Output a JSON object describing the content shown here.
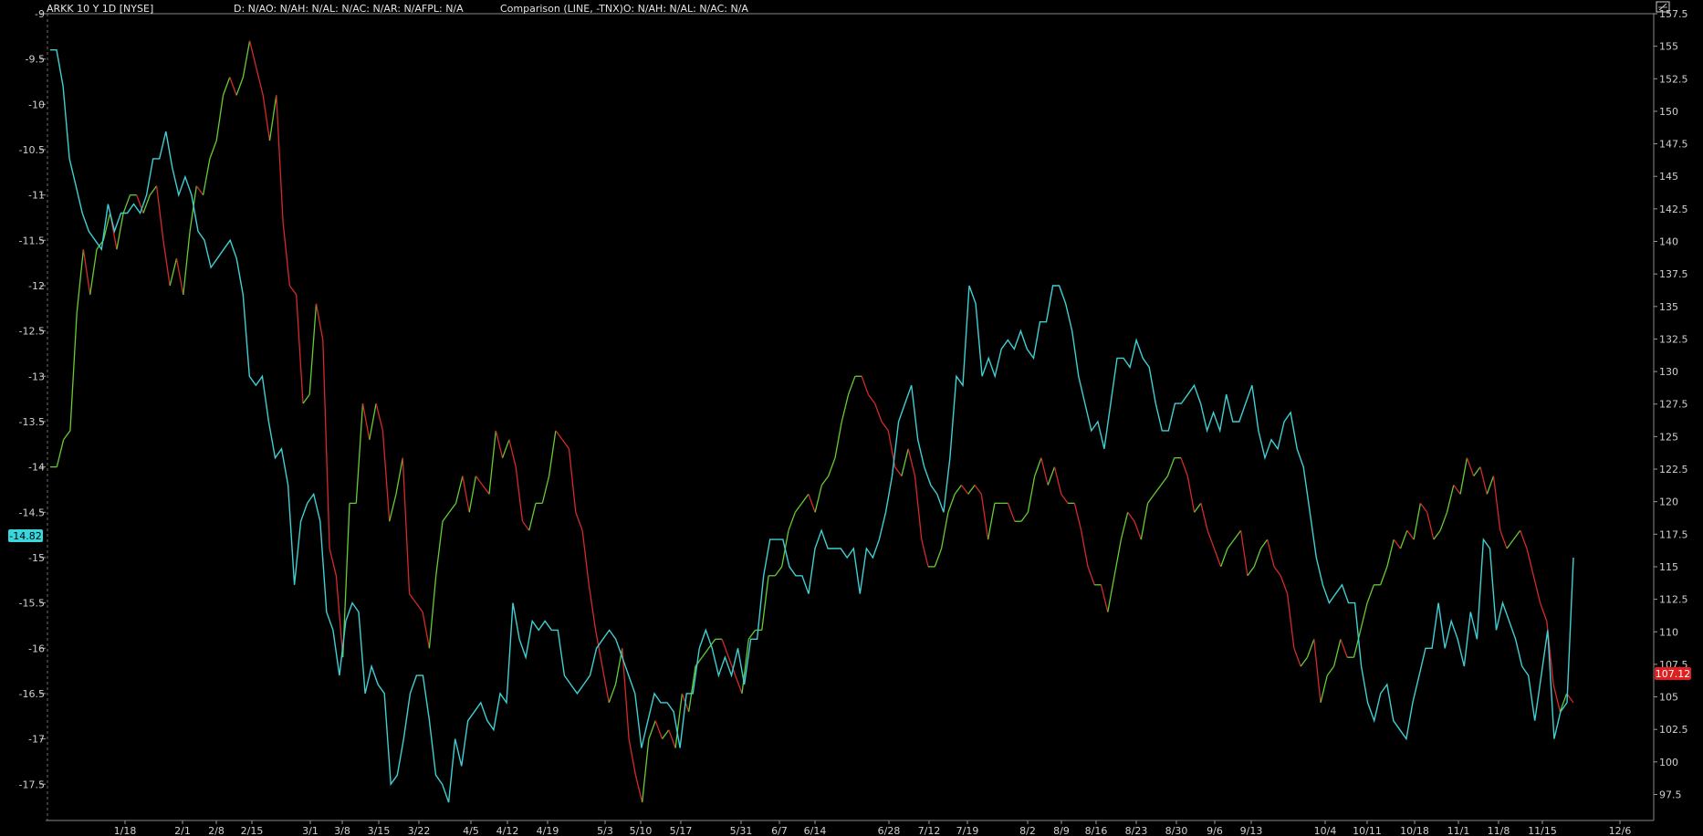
{
  "header": {
    "symbol": "ARKK 10 Y 1D [NYSE]",
    "study_line": "D: N/AO: N/AH: N/AL: N/AC: N/AR: N/AFPL: N/A",
    "comparison_line": "Comparison (LINE, -TNX)O: N/AH: N/AL: N/AC: N/A"
  },
  "colors": {
    "background": "#000000",
    "up": "#66cc33",
    "down": "#d42a2a",
    "comparison": "#3fcfd3",
    "axis": "#9a9a9a",
    "left_badge": "#39d7dd",
    "right_badge": "#e02020"
  },
  "badges": {
    "left_value": "-14.82",
    "right_value": "107.12"
  },
  "chart_data": {
    "type": "line",
    "x_ticks": [
      "1/18",
      "2/1",
      "2/8",
      "2/15",
      "3/1",
      "3/8",
      "3/15",
      "3/22",
      "4/5",
      "4/12",
      "4/19",
      "5/3",
      "5/10",
      "5/17",
      "5/31",
      "6/7",
      "6/14",
      "6/28",
      "7/12",
      "7/19",
      "8/2",
      "8/9",
      "8/16",
      "8/23",
      "8/30",
      "9/6",
      "9/13",
      "10/4",
      "10/11",
      "10/18",
      "11/1",
      "11/8",
      "11/15",
      "12/6"
    ],
    "left_axis": {
      "ylim": [
        -17.9,
        -9
      ],
      "ticks": [
        "-9",
        "-9.5",
        "-10",
        "-10.5",
        "-11",
        "-11.5",
        "-12",
        "-12.5",
        "-13",
        "-13.5",
        "-14",
        "-14.5",
        "-15",
        "-15.5",
        "-16",
        "-16.5",
        "-17",
        "-17.5"
      ]
    },
    "right_axis": {
      "ylim": [
        95.5,
        157.5
      ],
      "ticks": [
        "157.5",
        "155",
        "152.5",
        "150",
        "147.5",
        "145",
        "142.5",
        "140",
        "137.5",
        "135",
        "132.5",
        "130",
        "127.5",
        "125",
        "122.5",
        "120",
        "117.5",
        "115",
        "112.5",
        "110",
        "107.5",
        "105",
        "102.5",
        "100",
        "97.5"
      ]
    },
    "series": [
      {
        "axis": "left",
        "style": "updown",
        "values": [
          -14.0,
          -14.0,
          -13.7,
          -13.6,
          -12.3,
          -11.6,
          -12.1,
          -11.6,
          -11.5,
          -11.2,
          -11.6,
          -11.2,
          -11.0,
          -11.0,
          -11.2,
          -11.0,
          -10.9,
          -11.5,
          -12.0,
          -11.7,
          -12.1,
          -11.4,
          -10.9,
          -11.0,
          -10.6,
          -10.4,
          -9.9,
          -9.7,
          -9.9,
          -9.7,
          -9.3,
          -9.6,
          -9.9,
          -10.4,
          -9.9,
          -11.3,
          -12.0,
          -12.1,
          -13.3,
          -13.2,
          -12.2,
          -12.6,
          -14.9,
          -15.2,
          -16.1,
          -14.4,
          -14.4,
          -13.3,
          -13.7,
          -13.3,
          -13.6,
          -14.6,
          -14.3,
          -13.9,
          -15.4,
          -15.5,
          -15.6,
          -16.0,
          -15.2,
          -14.6,
          -14.5,
          -14.4,
          -14.1,
          -14.5,
          -14.1,
          -14.2,
          -14.3,
          -13.6,
          -13.9,
          -13.7,
          -14.0,
          -14.6,
          -14.7,
          -14.4,
          -14.4,
          -14.1,
          -13.6,
          -13.7,
          -13.8,
          -14.5,
          -14.7,
          -15.3,
          -15.8,
          -16.2,
          -16.6,
          -16.4,
          -16.0,
          -17.0,
          -17.4,
          -17.7,
          -17.0,
          -16.8,
          -17.0,
          -16.9,
          -17.1,
          -16.5,
          -16.7,
          -16.2,
          -16.1,
          -16.0,
          -15.9,
          -15.9,
          -16.1,
          -16.3,
          -16.5,
          -15.9,
          -15.8,
          -15.8,
          -15.2,
          -15.2,
          -15.1,
          -14.7,
          -14.5,
          -14.4,
          -14.3,
          -14.5,
          -14.2,
          -14.1,
          -13.9,
          -13.5,
          -13.2,
          -13.0,
          -13.0,
          -13.2,
          -13.3,
          -13.5,
          -13.6,
          -14.0,
          -14.1,
          -13.8,
          -14.1,
          -14.8,
          -15.1,
          -15.1,
          -14.9,
          -14.5,
          -14.3,
          -14.2,
          -14.3,
          -14.2,
          -14.3,
          -14.8,
          -14.4,
          -14.4,
          -14.4,
          -14.6,
          -14.6,
          -14.5,
          -14.1,
          -13.9,
          -14.2,
          -14.0,
          -14.3,
          -14.4,
          -14.4,
          -14.7,
          -15.1,
          -15.3,
          -15.3,
          -15.6,
          -15.2,
          -14.8,
          -14.5,
          -14.6,
          -14.8,
          -14.4,
          -14.3,
          -14.2,
          -14.1,
          -13.9,
          -13.9,
          -14.1,
          -14.5,
          -14.4,
          -14.7,
          -14.9,
          -15.1,
          -14.9,
          -14.8,
          -14.7,
          -15.2,
          -15.1,
          -14.9,
          -14.8,
          -15.1,
          -15.2,
          -15.4,
          -16.0,
          -16.2,
          -16.1,
          -15.9,
          -16.6,
          -16.3,
          -16.2,
          -15.9,
          -16.1,
          -16.1,
          -15.8,
          -15.5,
          -15.3,
          -15.3,
          -15.1,
          -14.8,
          -14.9,
          -14.7,
          -14.8,
          -14.4,
          -14.5,
          -14.8,
          -14.7,
          -14.5,
          -14.2,
          -14.3,
          -13.9,
          -14.1,
          -14.0,
          -14.3,
          -14.1,
          -14.7,
          -14.9,
          -14.8,
          -14.7,
          -14.9,
          -15.2,
          -15.5,
          -15.7,
          -16.4,
          -16.7,
          -16.5,
          -16.6
        ]
      },
      {
        "axis": "left",
        "style": "comparison",
        "values": [
          -9.4,
          -9.4,
          -9.8,
          -10.6,
          -10.9,
          -11.2,
          -11.4,
          -11.5,
          -11.6,
          -11.1,
          -11.4,
          -11.2,
          -11.2,
          -11.1,
          -11.2,
          -11.0,
          -10.6,
          -10.6,
          -10.3,
          -10.7,
          -11.0,
          -10.8,
          -11.0,
          -11.4,
          -11.5,
          -11.8,
          -11.7,
          -11.6,
          -11.5,
          -11.7,
          -12.1,
          -13.0,
          -13.1,
          -13.0,
          -13.5,
          -13.9,
          -13.8,
          -14.2,
          -15.3,
          -14.6,
          -14.4,
          -14.3,
          -14.6,
          -15.6,
          -15.8,
          -16.3,
          -15.7,
          -15.5,
          -15.6,
          -16.5,
          -16.2,
          -16.4,
          -16.5,
          -17.5,
          -17.4,
          -17.0,
          -16.5,
          -16.3,
          -16.3,
          -16.8,
          -17.4,
          -17.5,
          -17.7,
          -17.0,
          -17.3,
          -16.8,
          -16.7,
          -16.6,
          -16.8,
          -16.9,
          -16.5,
          -16.6,
          -15.5,
          -15.9,
          -16.1,
          -15.7,
          -15.8,
          -15.7,
          -15.8,
          -15.8,
          -16.3,
          -16.4,
          -16.5,
          -16.4,
          -16.3,
          -16.0,
          -15.9,
          -15.8,
          -15.9,
          -16.1,
          -16.3,
          -16.5,
          -17.1,
          -16.8,
          -16.5,
          -16.6,
          -16.6,
          -16.7,
          -17.1,
          -16.5,
          -16.5,
          -16.0,
          -15.8,
          -16.0,
          -16.3,
          -16.1,
          -16.3,
          -16.0,
          -16.4,
          -15.9,
          -15.9,
          -15.2,
          -14.8,
          -14.8,
          -14.8,
          -15.1,
          -15.2,
          -15.2,
          -15.4,
          -14.9,
          -14.7,
          -14.9,
          -14.9,
          -14.9,
          -15.0,
          -14.9,
          -15.4,
          -14.9,
          -15.0,
          -14.8,
          -14.5,
          -14.1,
          -13.5,
          -13.3,
          -13.1,
          -13.7,
          -14.0,
          -14.2,
          -14.3,
          -14.5,
          -13.9,
          -13.0,
          -13.1,
          -12.0,
          -12.2,
          -13.0,
          -12.8,
          -13.0,
          -12.7,
          -12.6,
          -12.7,
          -12.5,
          -12.7,
          -12.8,
          -12.4,
          -12.4,
          -12.0,
          -12.0,
          -12.2,
          -12.5,
          -13.0,
          -13.3,
          -13.6,
          -13.5,
          -13.8,
          -13.3,
          -12.8,
          -12.8,
          -12.9,
          -12.6,
          -12.8,
          -12.9,
          -13.3,
          -13.6,
          -13.6,
          -13.3,
          -13.3,
          -13.2,
          -13.1,
          -13.3,
          -13.6,
          -13.4,
          -13.6,
          -13.2,
          -13.5,
          -13.5,
          -13.3,
          -13.1,
          -13.6,
          -13.9,
          -13.7,
          -13.8,
          -13.5,
          -13.4,
          -13.8,
          -14.0,
          -14.5,
          -15.0,
          -15.3,
          -15.5,
          -15.4,
          -15.3,
          -15.5,
          -15.5,
          -16.2,
          -16.6,
          -16.8,
          -16.5,
          -16.4,
          -16.8,
          -16.9,
          -17.0,
          -16.6,
          -16.3,
          -16.0,
          -16.0,
          -15.5,
          -16.0,
          -15.7,
          -15.9,
          -16.2,
          -15.6,
          -15.9,
          -14.8,
          -14.9,
          -15.8,
          -15.5,
          -15.7,
          -15.9,
          -16.2,
          -16.3,
          -16.8,
          -16.3,
          -15.8,
          -17.0,
          -16.7,
          -16.6,
          -15.0
        ]
      }
    ]
  }
}
